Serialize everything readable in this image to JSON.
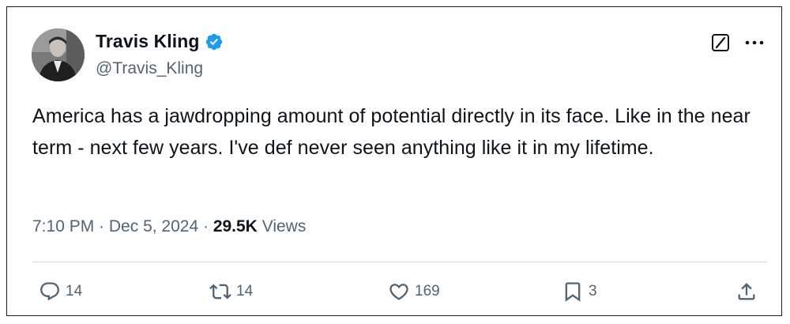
{
  "author": {
    "name": "Travis Kling",
    "handle": "@Travis_Kling",
    "verified": true,
    "verified_color": "#1d9bf0"
  },
  "header_icons": {
    "grok": "grok-icon",
    "more": "more-options-icon"
  },
  "tweet": {
    "text": "America has a jawdropping amount of potential directly in its face. Like in the near term - next few years. I've def never seen anything like it in my lifetime."
  },
  "meta": {
    "time": "7:10 PM",
    "separator": " · ",
    "date": "Dec 5, 2024",
    "views_count": "29.5K",
    "views_label": " Views"
  },
  "actions": {
    "reply": {
      "icon": "reply-icon",
      "count": "14"
    },
    "retweet": {
      "icon": "retweet-icon",
      "count": "14"
    },
    "like": {
      "icon": "heart-icon",
      "count": "169"
    },
    "bookmark": {
      "icon": "bookmark-icon",
      "count": "3"
    },
    "share": {
      "icon": "share-icon"
    }
  },
  "colors": {
    "text_primary": "#0f1419",
    "text_secondary": "#536471",
    "divider": "#cfd9de"
  }
}
